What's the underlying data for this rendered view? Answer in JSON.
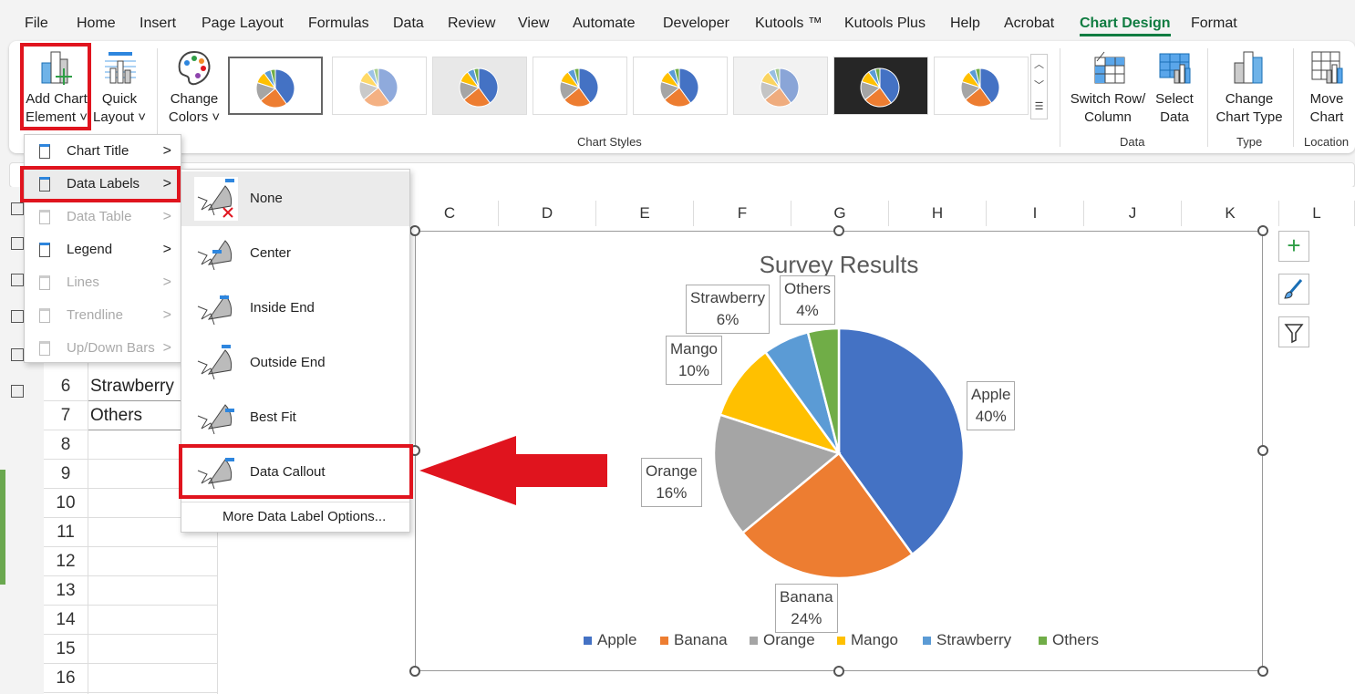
{
  "menu_tabs": [
    "File",
    "Home",
    "Insert",
    "Page Layout",
    "Formulas",
    "Data",
    "Review",
    "View",
    "Automate",
    "Developer",
    "Kutools ™",
    "Kutools Plus",
    "Help",
    "Acrobat",
    "Chart Design",
    "Format"
  ],
  "active_tab": "Chart Design",
  "ribbon": {
    "add_chart_element": [
      "Add Chart",
      "Element ˅"
    ],
    "quick_layout": [
      "Quick",
      "Layout ˅"
    ],
    "change_colors": [
      "Change",
      "Colors ˅"
    ],
    "chart_styles_label": "Chart Styles",
    "switch_row_column": [
      "Switch Row/",
      "Column"
    ],
    "select_data": [
      "Select",
      "Data"
    ],
    "data_group": "Data",
    "change_chart_type": [
      "Change",
      "Chart Type"
    ],
    "type_group": "Type",
    "move_chart": [
      "Move",
      "Chart"
    ],
    "location_group": "Location"
  },
  "add_element_menu": [
    {
      "label": "Chart Title",
      "enabled": true
    },
    {
      "label": "Data Labels",
      "enabled": true,
      "selected": true
    },
    {
      "label": "Data Table",
      "enabled": false
    },
    {
      "label": "Legend",
      "enabled": true
    },
    {
      "label": "Lines",
      "enabled": false
    },
    {
      "label": "Trendline",
      "enabled": false
    },
    {
      "label": "Up/Down Bars",
      "enabled": false
    }
  ],
  "data_labels_submenu": [
    "None",
    "Center",
    "Inside End",
    "Outside End",
    "Best Fit",
    "Data Callout"
  ],
  "more_options": "More Data Label Options...",
  "highlighted_option": "Data Callout",
  "columns": [
    "C",
    "D",
    "E",
    "F",
    "G",
    "H",
    "I",
    "J",
    "K",
    "L"
  ],
  "rows": [
    "6",
    "7",
    "8",
    "9",
    "10",
    "11",
    "12",
    "13",
    "14",
    "15",
    "16"
  ],
  "cells": {
    "6": "Strawberry",
    "7": "Others"
  },
  "chart_data": {
    "type": "pie",
    "title": "Survey Results",
    "categories": [
      "Apple",
      "Banana",
      "Orange",
      "Mango",
      "Strawberry",
      "Others"
    ],
    "values": [
      40,
      24,
      16,
      10,
      6,
      4
    ],
    "labels": [
      "40%",
      "24%",
      "16%",
      "10%",
      "6%",
      "4%"
    ],
    "colors": [
      "#4472c4",
      "#ed7d31",
      "#a5a5a5",
      "#ffc000",
      "#5b9bd5",
      "#70ad47"
    ],
    "data_labels": "callout",
    "legend": "bottom"
  },
  "colors": {
    "accent": "#107c41",
    "highlight": "#e0141e"
  }
}
